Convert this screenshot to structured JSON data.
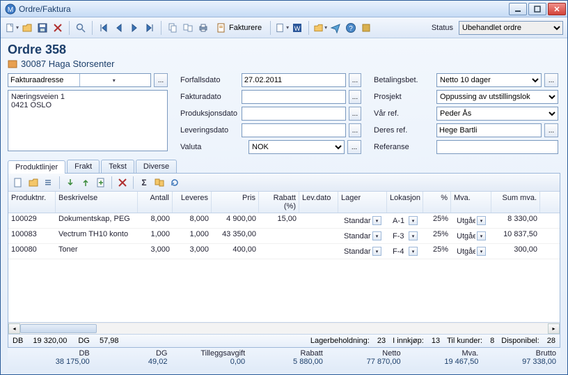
{
  "window": {
    "title": "Ordre/Faktura"
  },
  "toolbar": {
    "fakturere": "Fakturere",
    "status_label": "Status",
    "status_value": "Ubehandlet ordre"
  },
  "order": {
    "title": "Ordre 358",
    "customer": "30087 Haga Storsenter"
  },
  "address": {
    "selector": "Fakturaadresse",
    "line1": "Næringsveien 1",
    "line2": "0421 OSLO"
  },
  "fields": {
    "forfall_label": "Forfallsdato",
    "forfall": "27.02.2011",
    "fakturadato_label": "Fakturadato",
    "fakturadato": "",
    "prod_label": "Produksjonsdato",
    "prod": "",
    "lev_label": "Leveringsdato",
    "lev": "",
    "valuta_label": "Valuta",
    "valuta": "NOK",
    "bet_label": "Betalingsbet.",
    "bet": "Netto 10 dager",
    "prosjekt_label": "Prosjekt",
    "prosjekt": "Oppussing av utstillingslok",
    "varref_label": "Vår ref.",
    "varref": "Peder Ås",
    "deresref_label": "Deres ref.",
    "deresref": "Hege Bartli",
    "ref_label": "Referanse",
    "ref": ""
  },
  "tabs": {
    "produktlinjer": "Produktlinjer",
    "frakt": "Frakt",
    "tekst": "Tekst",
    "diverse": "Diverse"
  },
  "grid": {
    "headers": {
      "nr": "Produktnr.",
      "desc": "Beskrivelse",
      "ant": "Antall",
      "lev": "Leveres",
      "pris": "Pris",
      "rab": "Rabatt (%)",
      "levd": "Lev.dato",
      "lager": "Lager",
      "lok": "Lokasjon",
      "pct": "%",
      "mva": "Mva.",
      "sum": "Sum mva."
    },
    "rows": [
      {
        "nr": "100029",
        "desc": "Dokumentskap, PEG",
        "ant": "8,000",
        "lev": "8,000",
        "pris": "4 900,00",
        "rab": "15,00",
        "levd": "",
        "lager": "Standard",
        "lok": "A-1",
        "pct": "25%",
        "mva": "Utgående",
        "sum": "8 330,00"
      },
      {
        "nr": "100083",
        "desc": "Vectrum TH10 konto",
        "ant": "1,000",
        "lev": "1,000",
        "pris": "43 350,00",
        "rab": "",
        "levd": "",
        "lager": "Standard",
        "lok": "F-3",
        "pct": "25%",
        "mva": "Utgående",
        "sum": "10 837,50"
      },
      {
        "nr": "100080",
        "desc": "Toner",
        "ant": "3,000",
        "lev": "3,000",
        "pris": "400,00",
        "rab": "",
        "levd": "",
        "lager": "Standard",
        "lok": "F-4",
        "pct": "25%",
        "mva": "Utgående",
        "sum": "300,00"
      }
    ]
  },
  "status": {
    "db_label": "DB",
    "db": "19 320,00",
    "dg_label": "DG",
    "dg": "57,98",
    "lager_label": "Lagerbeholdning:",
    "lager": "23",
    "innkjop_label": "I innkjøp:",
    "innkjop": "13",
    "kunder_label": "Til kunder:",
    "kunder": "8",
    "disp_label": "Disponibel:",
    "disp": "28"
  },
  "totals": {
    "db_label": "DB",
    "db": "38 175,00",
    "dg_label": "DG",
    "dg": "49,02",
    "tillegg_label": "Tilleggsavgift",
    "tillegg": "0,00",
    "rabatt_label": "Rabatt",
    "rabatt": "5 880,00",
    "netto_label": "Netto",
    "netto": "77 870,00",
    "mva_label": "Mva.",
    "mva": "19 467,50",
    "brutto_label": "Brutto",
    "brutto": "97 338,00"
  }
}
